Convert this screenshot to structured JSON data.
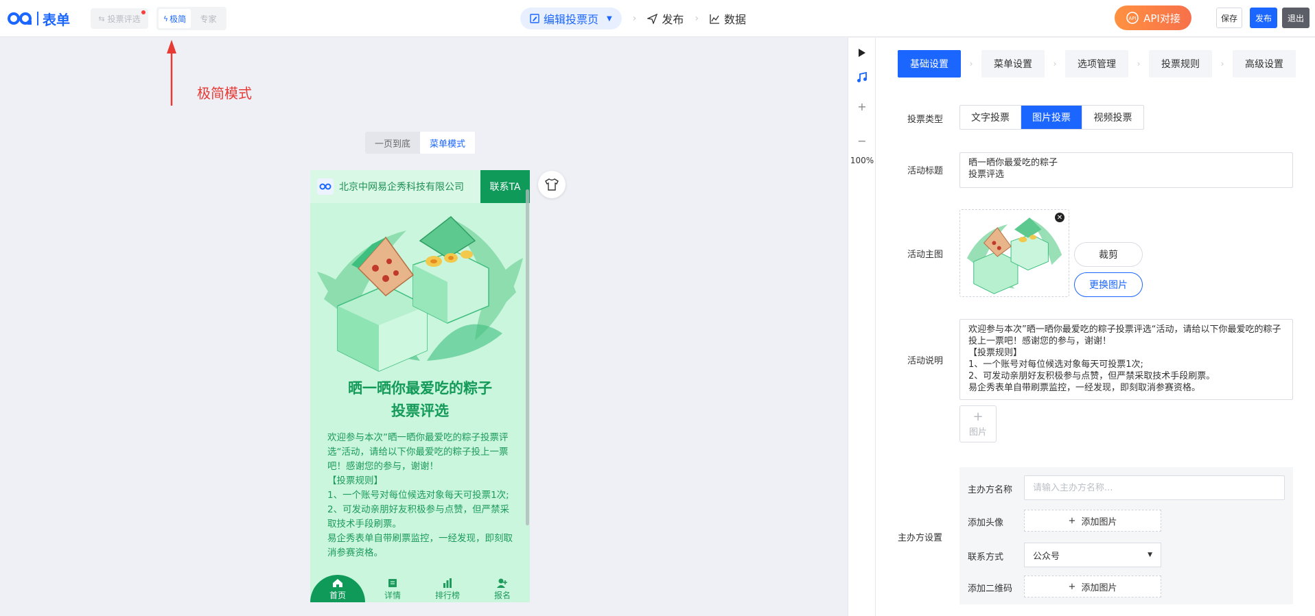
{
  "app": {
    "logo_text": "表单",
    "back_label": "投票评选",
    "modes": [
      "极简",
      "专家"
    ],
    "active_mode": 0
  },
  "steps": {
    "edit": "编辑投票页",
    "publish": "发布",
    "data": "数据"
  },
  "actions": {
    "api": "API对接",
    "save": "保存",
    "publish": "发布",
    "exit": "退出"
  },
  "annotation": {
    "label": "极简模式",
    "color": "#e83a35"
  },
  "preview": {
    "view_modes": [
      "一页到底",
      "菜单模式"
    ],
    "active_view": 1,
    "company": "北京中网易企秀科技有限公司",
    "contact": "联系TA",
    "title": "晒一晒你最爱吃的粽子\n投票评选",
    "description": "欢迎参与本次”晒一晒你最爱吃的粽子投票评选“活动，请给以下你最爱吃的粽子投上一票吧！感谢您的参与，谢谢！\n【投票规则】\n1、一个账号对每位候选对象每天可投票1次;\n2、可发动亲朋好友积极参与点赞，但严禁采取技术手段刷票。\n易企秀表单自带刷票监控，一经发现，即刻取消参赛资格。",
    "tabs": [
      "首页",
      "详情",
      "排行榜",
      "报名"
    ],
    "theme_color": "#0f9a5a"
  },
  "tools": {
    "zoom": "100%"
  },
  "settings": {
    "tabs": [
      "基础设置",
      "菜单设置",
      "选项管理",
      "投票规则",
      "高级设置"
    ],
    "active_tab": 0,
    "vote_type_label": "投票类型",
    "vote_types": [
      "文字投票",
      "图片投票",
      "视频投票"
    ],
    "active_vote_type": 1,
    "title_label": "活动标题",
    "title_value": "晒一晒你最爱吃的粽子\n投票评选",
    "image_label": "活动主图",
    "crop": "裁剪",
    "replace_image": "更换图片",
    "desc_label": "活动说明",
    "desc_value": "欢迎参与本次”晒一晒你最爱吃的粽子投票评选“活动，请给以下你最爱吃的粽子投上一票吧！感谢您的参与，谢谢！\n【投票规则】\n1、一个账号对每位候选对象每天可投票1次;\n2、可发动亲朋好友积极参与点赞，但严禁采取技术手段刷票。\n易企秀表单自带刷票监控，一经发现，即刻取消参赛资格。",
    "add_picture": "图片",
    "organizer_label": "主办方设置",
    "org_name_label": "主办方名称",
    "org_name_placeholder": "请输入主办方名称...",
    "avatar_label": "添加头像",
    "add_image": "添加图片",
    "contact_label": "联系方式",
    "contact_value": "公众号",
    "qrcode_label": "添加二维码"
  }
}
